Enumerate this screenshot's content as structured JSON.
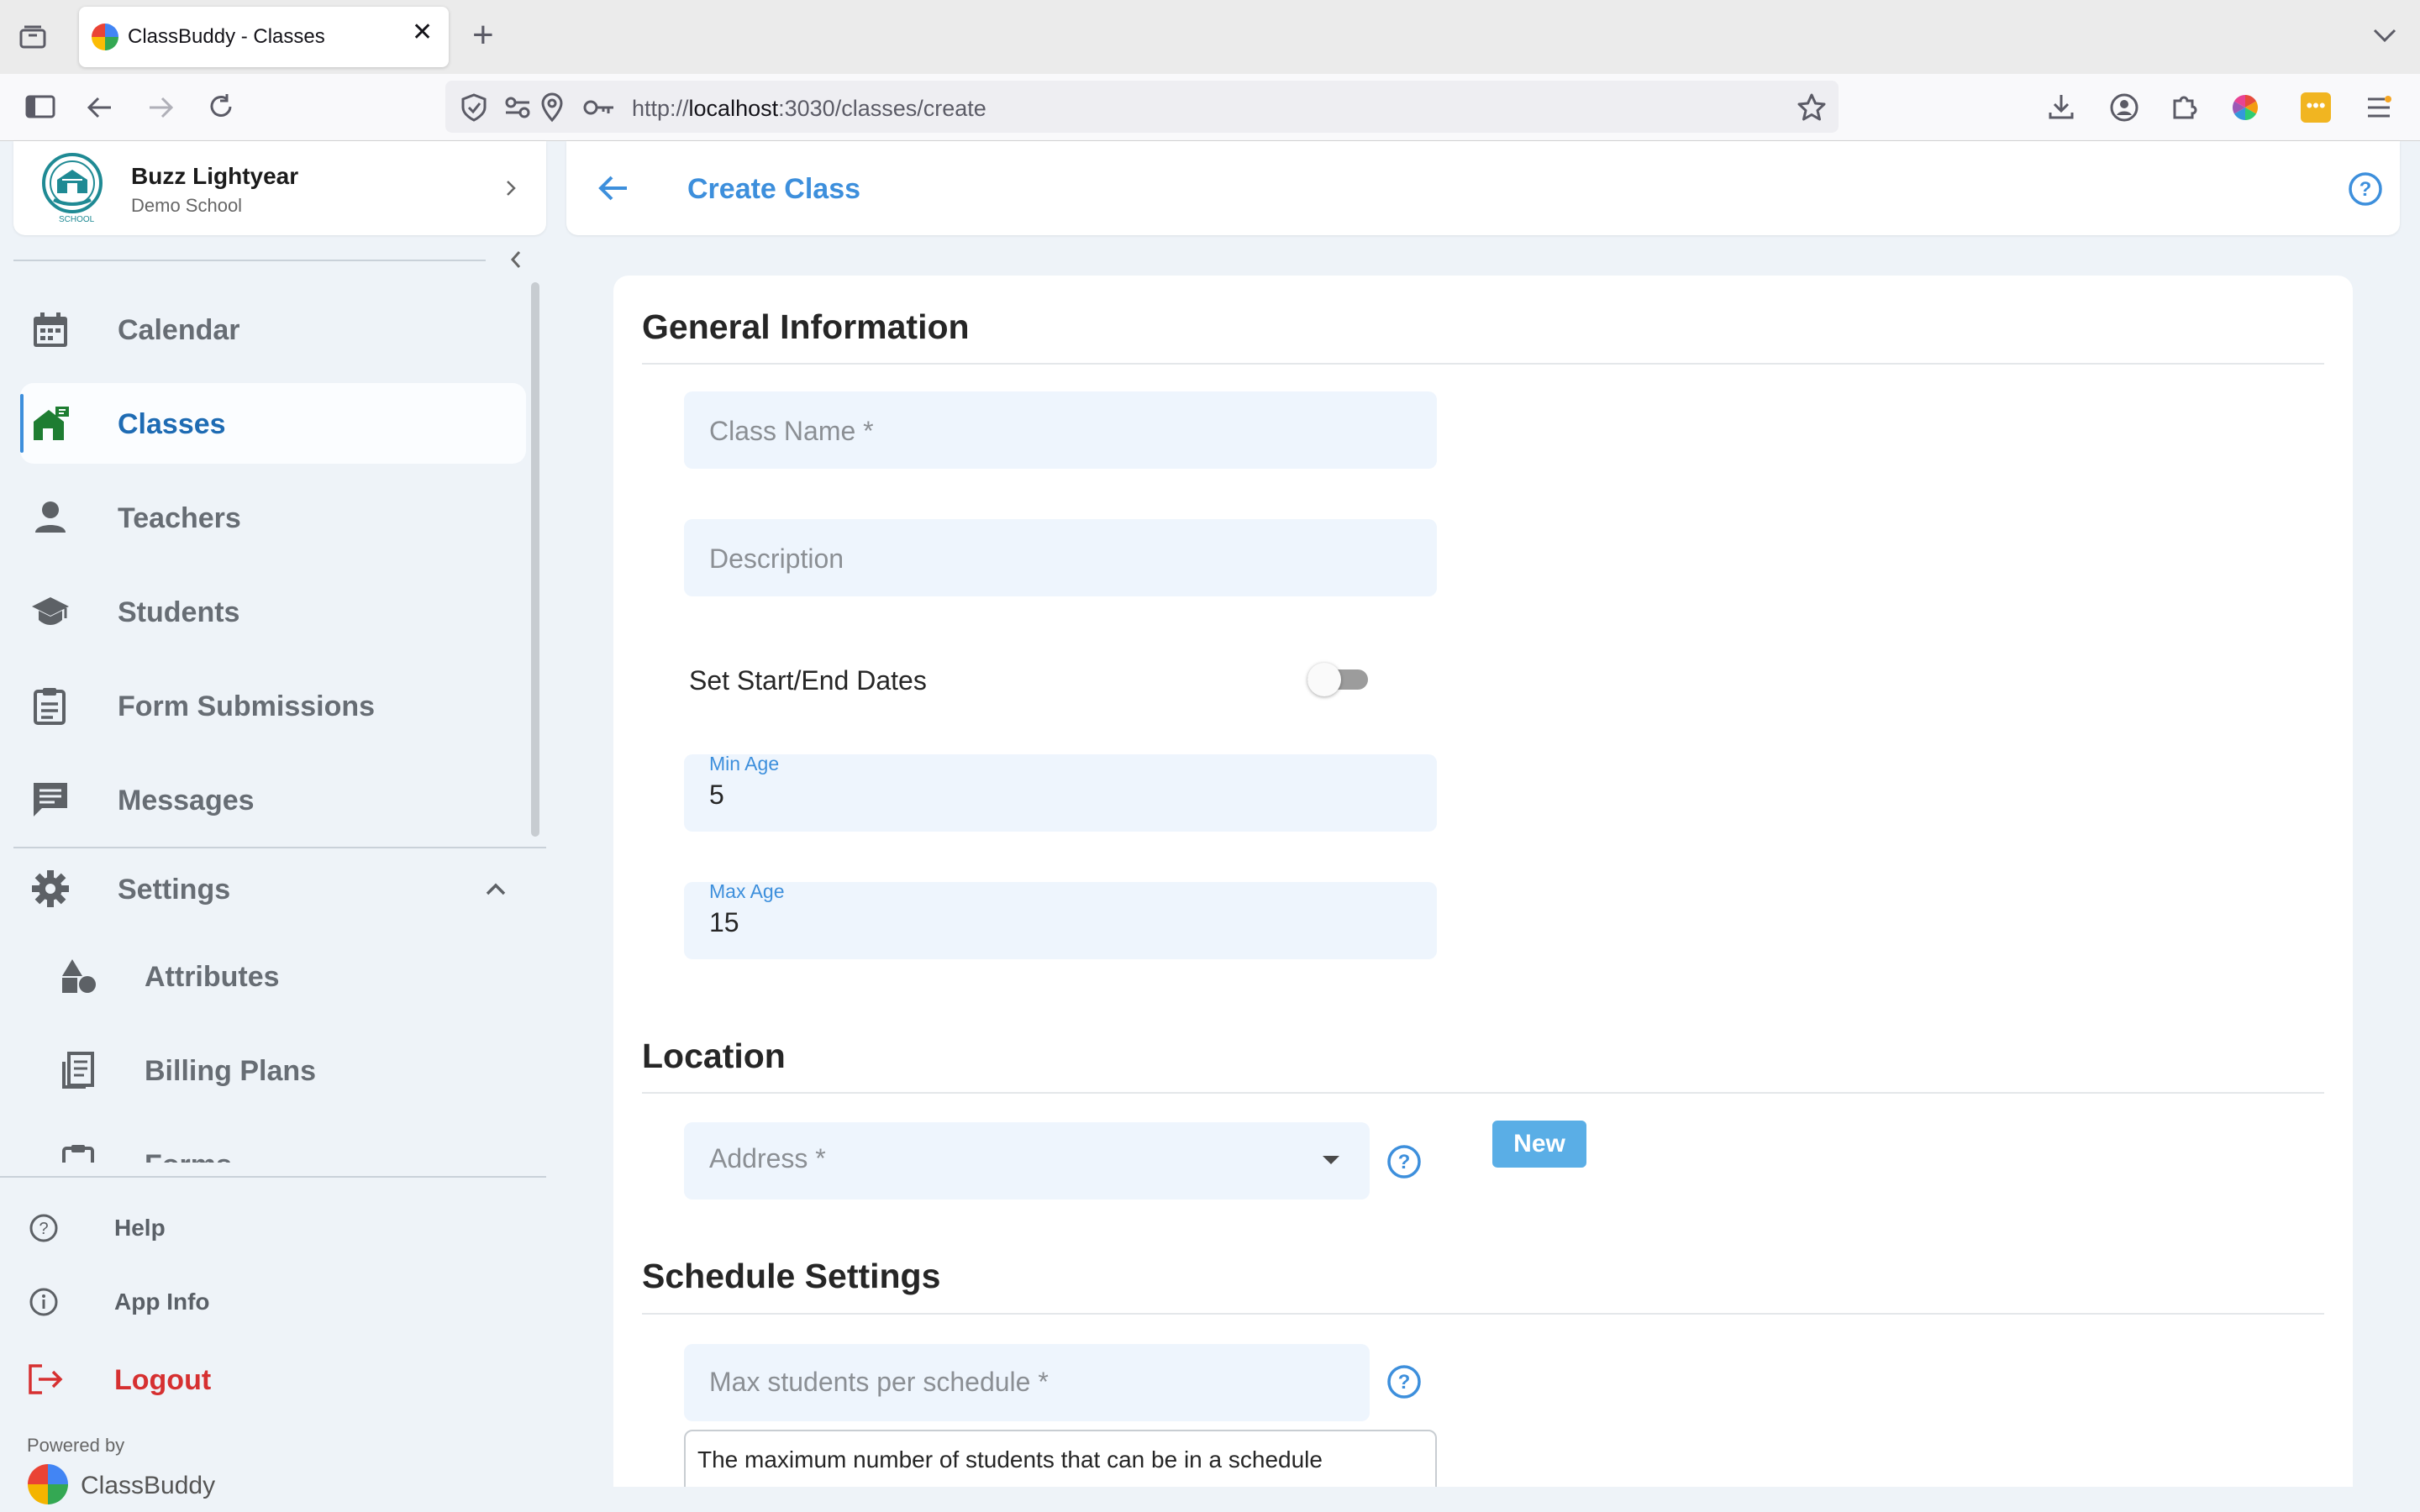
{
  "browser": {
    "tab_title": "ClassBuddy - Classes",
    "url_prefix": "http://",
    "url_host": "localhost",
    "url_path": ":3030/classes/create"
  },
  "profile": {
    "user_name": "Buzz Lightyear",
    "school_name": "Demo School",
    "logo_caption": "SCHOOL"
  },
  "sidebar": {
    "items": [
      {
        "label": "Calendar",
        "icon": "calendar-icon"
      },
      {
        "label": "Classes",
        "icon": "classroom-icon",
        "active": true
      },
      {
        "label": "Teachers",
        "icon": "person-icon"
      },
      {
        "label": "Students",
        "icon": "graduation-cap-icon"
      },
      {
        "label": "Form Submissions",
        "icon": "clipboard-icon"
      },
      {
        "label": "Messages",
        "icon": "message-icon"
      },
      {
        "label": "Settings",
        "icon": "gear-icon",
        "expanded": true
      }
    ],
    "sub_items": [
      {
        "label": "Attributes",
        "icon": "shapes-icon"
      },
      {
        "label": "Billing Plans",
        "icon": "receipt-icon"
      },
      {
        "label": "Forms",
        "icon": "form-icon"
      }
    ],
    "bottom": {
      "help": "Help",
      "app_info": "App Info",
      "logout": "Logout"
    },
    "powered_by": "Powered by",
    "brand": "ClassBuddy"
  },
  "header": {
    "title": "Create Class"
  },
  "form": {
    "general_title": "General Information",
    "class_name_placeholder": "Class Name *",
    "description_placeholder": "Description",
    "dates_toggle_label": "Set Start/End Dates",
    "dates_toggle_on": false,
    "min_age_label": "Min Age",
    "min_age_value": "5",
    "max_age_label": "Max Age",
    "max_age_value": "15",
    "location_title": "Location",
    "address_placeholder": "Address *",
    "new_button": "New",
    "schedule_title": "Schedule Settings",
    "max_students_placeholder": "Max students per schedule *",
    "max_students_hint": "The maximum number of students that can be in a schedule"
  },
  "colors": {
    "accent": "#3d8fdc",
    "logout": "#d63031",
    "badge": "#5aaee6"
  }
}
